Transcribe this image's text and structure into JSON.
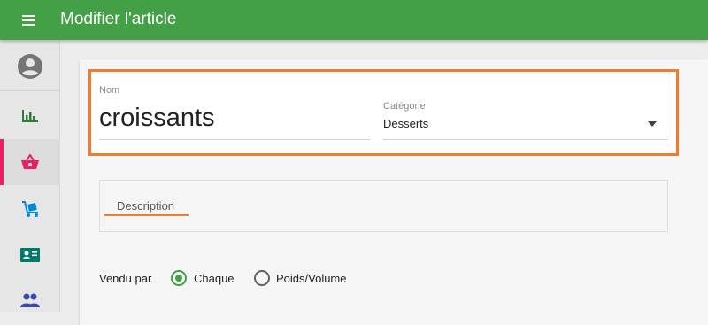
{
  "header": {
    "title": "Modifier l'article",
    "color": "#43a047"
  },
  "sidebar": {
    "items": [
      {
        "name": "account",
        "icon": "account-circle-icon",
        "active": false
      },
      {
        "name": "statistics",
        "icon": "bar-chart-icon",
        "color": "#2e7d32",
        "active": false
      },
      {
        "name": "articles",
        "icon": "basket-icon",
        "color": "#e91e63",
        "active": true
      },
      {
        "name": "suppliers",
        "icon": "hand-truck-icon",
        "color": "#0288d1",
        "active": false
      },
      {
        "name": "staff",
        "icon": "id-card-icon",
        "color": "#00796b",
        "active": false
      },
      {
        "name": "users",
        "icon": "people-icon",
        "color": "#3949ab",
        "active": false
      }
    ]
  },
  "form": {
    "name": {
      "label": "Nom",
      "value": "croissants"
    },
    "category": {
      "label": "Catégorie",
      "value": "Desserts"
    },
    "description": {
      "label": "Description",
      "value": ""
    },
    "sold_by": {
      "label": "Vendu par",
      "options": [
        {
          "label": "Chaque",
          "checked": true
        },
        {
          "label": "Poids/Volume",
          "checked": false
        }
      ]
    },
    "highlight_color": "#ef7d2f"
  }
}
